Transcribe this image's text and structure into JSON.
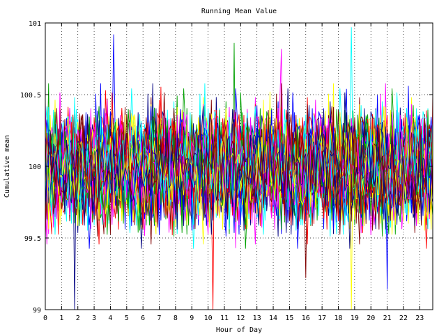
{
  "chart_data": {
    "type": "line",
    "title": "Running Mean Value",
    "xlabel": "Hour of Day",
    "ylabel": "Cumulative mean",
    "xlim": [
      0,
      23.8
    ],
    "ylim": [
      99,
      101
    ],
    "x_ticks": [
      "0",
      "1",
      "2",
      "3",
      "4",
      "5",
      "6",
      "7",
      "8",
      "9",
      "10",
      "11",
      "12",
      "13",
      "14",
      "15",
      "16",
      "17",
      "18",
      "19",
      "20",
      "21",
      "22",
      "23"
    ],
    "y_ticks": [
      "99",
      "99.5",
      "100",
      "100.5",
      "101"
    ],
    "grid": true,
    "legend": "none",
    "series_colors": [
      "#0000ff",
      "#ff0000",
      "#00a000",
      "#ff00ff",
      "#00ffff",
      "#ffff00",
      "#000080",
      "#800000"
    ],
    "series_count": 48,
    "samples_per_hour": 10,
    "center_value": 100,
    "typical_spread": 0.18,
    "notable_spikes": [
      {
        "x": 4.2,
        "y": 100.92
      },
      {
        "x": 10.3,
        "y": 99.0
      },
      {
        "x": 11.6,
        "y": 100.86
      },
      {
        "x": 14.5,
        "y": 100.82
      },
      {
        "x": 18.8,
        "y": 100.97
      },
      {
        "x": 18.8,
        "y": 99.0
      },
      {
        "x": 1.8,
        "y": 99.0
      },
      {
        "x": 16.0,
        "y": 99.22
      },
      {
        "x": 21.0,
        "y": 99.14
      }
    ]
  }
}
